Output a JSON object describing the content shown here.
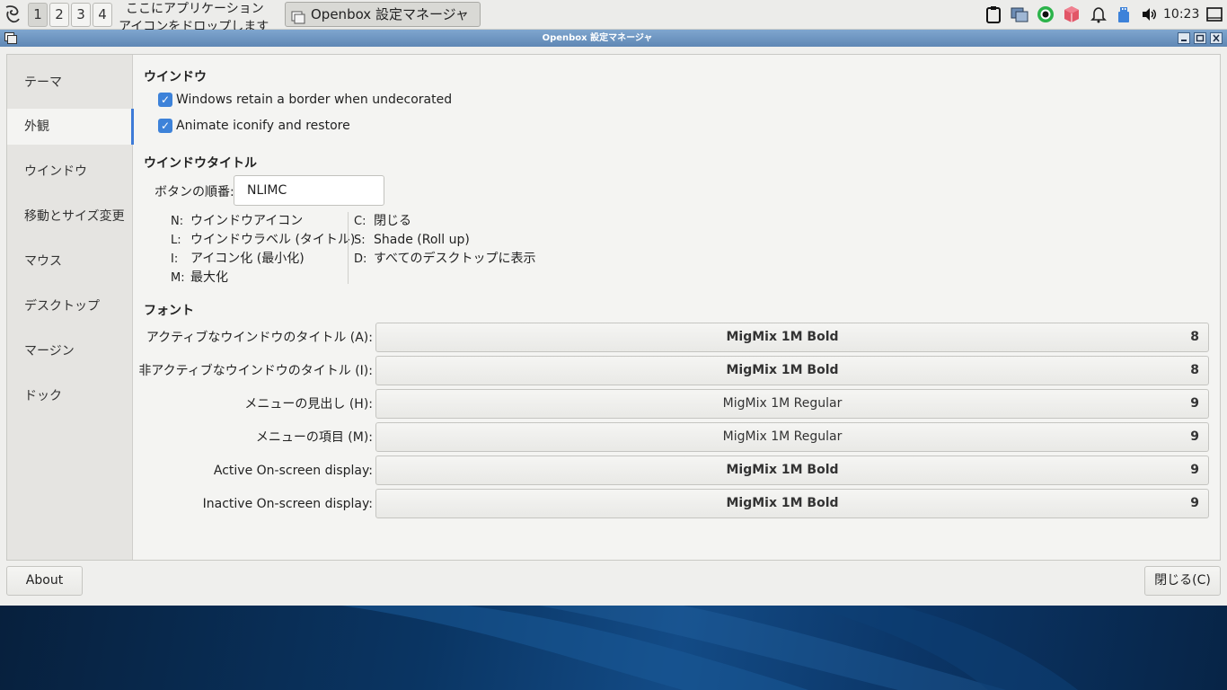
{
  "taskbar": {
    "workspaces": [
      "1",
      "2",
      "3",
      "4"
    ],
    "active_workspace": "1",
    "launcher_hint_line1": "ここにアプリケーション",
    "launcher_hint_line2": "アイコンをドロップします",
    "task_label": "Openbox 設定マネージャ",
    "clock": "10:23",
    "tray_icons": [
      "clipboard-icon",
      "window-manager-icon",
      "record-icon",
      "package-icon",
      "notification-bell-icon",
      "usb-icon",
      "volume-icon",
      "display-icon"
    ]
  },
  "window": {
    "title": "Openbox 設定マネージャ"
  },
  "sidebar": {
    "items": [
      {
        "label": "テーマ"
      },
      {
        "label": "外観"
      },
      {
        "label": "ウインドウ"
      },
      {
        "label": "移動とサイズ変更"
      },
      {
        "label": "マウス"
      },
      {
        "label": "デスクトップ"
      },
      {
        "label": "マージン"
      },
      {
        "label": "ドック"
      }
    ],
    "active": "外観"
  },
  "main": {
    "window_section": {
      "title": "ウインドウ",
      "options": [
        {
          "label": "Windows retain a border when undecorated",
          "checked": true
        },
        {
          "label": "Animate iconify and restore",
          "checked": true
        }
      ]
    },
    "titlebar_section": {
      "title": "ウインドウタイトル",
      "order_label": "ボタンの順番:",
      "order_value": "NLIMC",
      "legend_left": [
        {
          "key": "N:",
          "text": "ウインドウアイコン"
        },
        {
          "key": "L:",
          "text": "ウインドウラベル (タイトル)"
        },
        {
          "key": "I:",
          "text": "アイコン化 (最小化)"
        },
        {
          "key": "M:",
          "text": "最大化"
        }
      ],
      "legend_right": [
        {
          "key": "C:",
          "text": "閉じる"
        },
        {
          "key": "S:",
          "text": "Shade (Roll up)"
        },
        {
          "key": "D:",
          "text": "すべてのデスクトップに表示"
        }
      ]
    },
    "font_section": {
      "title": "フォント",
      "rows": [
        {
          "label": "アクティブなウインドウのタイトル (A):",
          "font": "MigMix 1M Bold",
          "size": "8",
          "bold": true
        },
        {
          "label": "非アクティブなウインドウのタイトル (I):",
          "font": "MigMix 1M Bold",
          "size": "8",
          "bold": true
        },
        {
          "label": "メニューの見出し (H):",
          "font": "MigMix 1M Regular",
          "size": "9",
          "bold": false
        },
        {
          "label": "メニューの項目 (M):",
          "font": "MigMix 1M Regular",
          "size": "9",
          "bold": false
        },
        {
          "label": "Active On-screen display:",
          "font": "MigMix 1M Bold",
          "size": "9",
          "bold": true
        },
        {
          "label": "Inactive On-screen display:",
          "font": "MigMix 1M Bold",
          "size": "9",
          "bold": true
        }
      ]
    }
  },
  "buttons": {
    "about": "About",
    "close": "閉じる(C)"
  },
  "colors": {
    "accent": "#3d82d9",
    "titlebar": "#6d94c1"
  }
}
